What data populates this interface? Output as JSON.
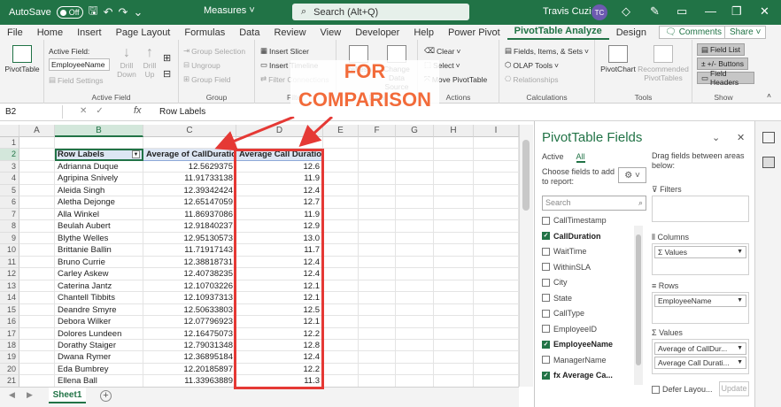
{
  "titlebar": {
    "autosave_label": "AutoSave",
    "autosave_state": "Off",
    "workbook_name": "Measures ˅",
    "search_placeholder": "Search (Alt+Q)",
    "user_name": "Travis Cuzick",
    "user_initials": "TC",
    "window_controls": [
      "minimize",
      "restore",
      "close"
    ]
  },
  "menu": {
    "tabs": [
      "File",
      "Home",
      "Insert",
      "Page Layout",
      "Formulas",
      "Data",
      "Review",
      "View",
      "Developer",
      "Help",
      "Power Pivot",
      "PivotTable Analyze",
      "Design"
    ],
    "active_tab": "PivotTable Analyze",
    "comments_label": "Comments",
    "share_label": "Share ˅"
  },
  "ribbon": {
    "pivottable_label": "PivotTable",
    "active_field": {
      "label": "Active Field:",
      "value": "EmployeeName",
      "settings_label": "Field Settings",
      "drill_down_label": "Drill Down",
      "drill_up_label": "Drill Up",
      "group_label": "Active Field"
    },
    "group": {
      "group_selection": "Group Selection",
      "ungroup": "Ungroup",
      "group_field": "Group Field",
      "group_label": "Group"
    },
    "filter": {
      "insert_slicer": "Insert Slicer",
      "insert_timeline": "Insert Timeline",
      "filter_connections": "Filter Connections",
      "group_label": "Filter"
    },
    "data": {
      "refresh": "Refresh",
      "change_source": "Change Data Source",
      "group_label": "Data"
    },
    "actions": {
      "clear": "Clear",
      "select": "Select",
      "move": "Move PivotTable",
      "group_label": "Actions"
    },
    "calculations": {
      "fields_items_sets": "Fields, Items, & Sets",
      "olap_tools": "OLAP Tools",
      "relationships": "Relationships",
      "group_label": "Calculations"
    },
    "tools": {
      "pivotchart": "PivotChart",
      "recommended": "Recommended PivotTables",
      "group_label": "Tools"
    },
    "show": {
      "field_list": "Field List",
      "buttons": "+/- Buttons",
      "field_headers": "Field Headers",
      "group_label": "Show"
    }
  },
  "formula_bar": {
    "name_box": "B2",
    "formula": "Row Labels"
  },
  "columns": [
    "A",
    "B",
    "C",
    "D",
    "E",
    "F",
    "G",
    "H",
    "I"
  ],
  "rows": [
    1,
    2,
    3,
    4,
    5,
    6,
    7,
    8,
    9,
    10,
    11,
    12,
    13,
    14,
    15,
    16,
    17,
    18,
    19,
    20,
    21
  ],
  "headers": {
    "row_labels": "Row Labels",
    "avg_callduration": "Average of CallDuration",
    "avg_call_duration": "Average Call Duration"
  },
  "table": [
    {
      "name": "Adrianna Duque",
      "c": "12.5629375",
      "d": "12.6"
    },
    {
      "name": "Agripina Snively",
      "c": "11.91733138",
      "d": "11.9"
    },
    {
      "name": "Aleida Singh",
      "c": "12.39342424",
      "d": "12.4"
    },
    {
      "name": "Aletha Dejonge",
      "c": "12.65147059",
      "d": "12.7"
    },
    {
      "name": "Alla Winkel",
      "c": "11.86937086",
      "d": "11.9"
    },
    {
      "name": "Beulah Aubert",
      "c": "12.91840237",
      "d": "12.9"
    },
    {
      "name": "Blythe Welles",
      "c": "12.95130573",
      "d": "13.0"
    },
    {
      "name": "Brittanie Ballin",
      "c": "11.71917143",
      "d": "11.7"
    },
    {
      "name": "Bruno Currie",
      "c": "12.38818731",
      "d": "12.4"
    },
    {
      "name": "Carley Askew",
      "c": "12.40738235",
      "d": "12.4"
    },
    {
      "name": "Caterina Jantz",
      "c": "12.10703226",
      "d": "12.1"
    },
    {
      "name": "Chantell Tibbits",
      "c": "12.10937313",
      "d": "12.1"
    },
    {
      "name": "Deandre Smyre",
      "c": "12.50633803",
      "d": "12.5"
    },
    {
      "name": "Debora Wilker",
      "c": "12.07796923",
      "d": "12.1"
    },
    {
      "name": "Dolores Lundeen",
      "c": "12.16475073",
      "d": "12.2"
    },
    {
      "name": "Dorathy Staiger",
      "c": "12.79031348",
      "d": "12.8"
    },
    {
      "name": "Dwana Rymer",
      "c": "12.36895184",
      "d": "12.4"
    },
    {
      "name": "Eda Bumbrey",
      "c": "12.20185897",
      "d": "12.2"
    },
    {
      "name": "Ellena Ball",
      "c": "11.33963889",
      "d": "11.3"
    }
  ],
  "callout": {
    "line1": "FOR",
    "line2": "COMPARISON",
    "color": "#f26b3a",
    "box_color": "#e53935"
  },
  "sheet": {
    "tab_name": "Sheet1",
    "add_label": "+"
  },
  "pivot_pane": {
    "title": "PivotTable Fields",
    "tab_active": "Active",
    "tab_all": "All",
    "choose_text": "Choose fields to add to report:",
    "drag_text": "Drag fields between areas below:",
    "search_placeholder": "Search",
    "fields": [
      {
        "name": "CallTimestamp",
        "checked": false,
        "bold": false
      },
      {
        "name": "CallDuration",
        "checked": true,
        "bold": true
      },
      {
        "name": "WaitTime",
        "checked": false,
        "bold": false
      },
      {
        "name": "WithinSLA",
        "checked": false,
        "bold": false
      },
      {
        "name": "City",
        "checked": false,
        "bold": false
      },
      {
        "name": "State",
        "checked": false,
        "bold": false
      },
      {
        "name": "CallType",
        "checked": false,
        "bold": false
      },
      {
        "name": "EmployeeID",
        "checked": false,
        "bold": false
      },
      {
        "name": "EmployeeName",
        "checked": true,
        "bold": true
      },
      {
        "name": "ManagerName",
        "checked": false,
        "bold": false
      },
      {
        "name": "fx Average Ca...",
        "checked": true,
        "bold": true
      }
    ],
    "filters_label": "Filters",
    "columns_label": "Columns",
    "columns_item": "Σ Values",
    "rows_label": "Rows",
    "rows_item": "EmployeeName",
    "values_label": "Values",
    "values_items": [
      "Average of CallDur...",
      "Average Call Durati..."
    ],
    "defer_label": "Defer Layou...",
    "update_label": "Update"
  }
}
